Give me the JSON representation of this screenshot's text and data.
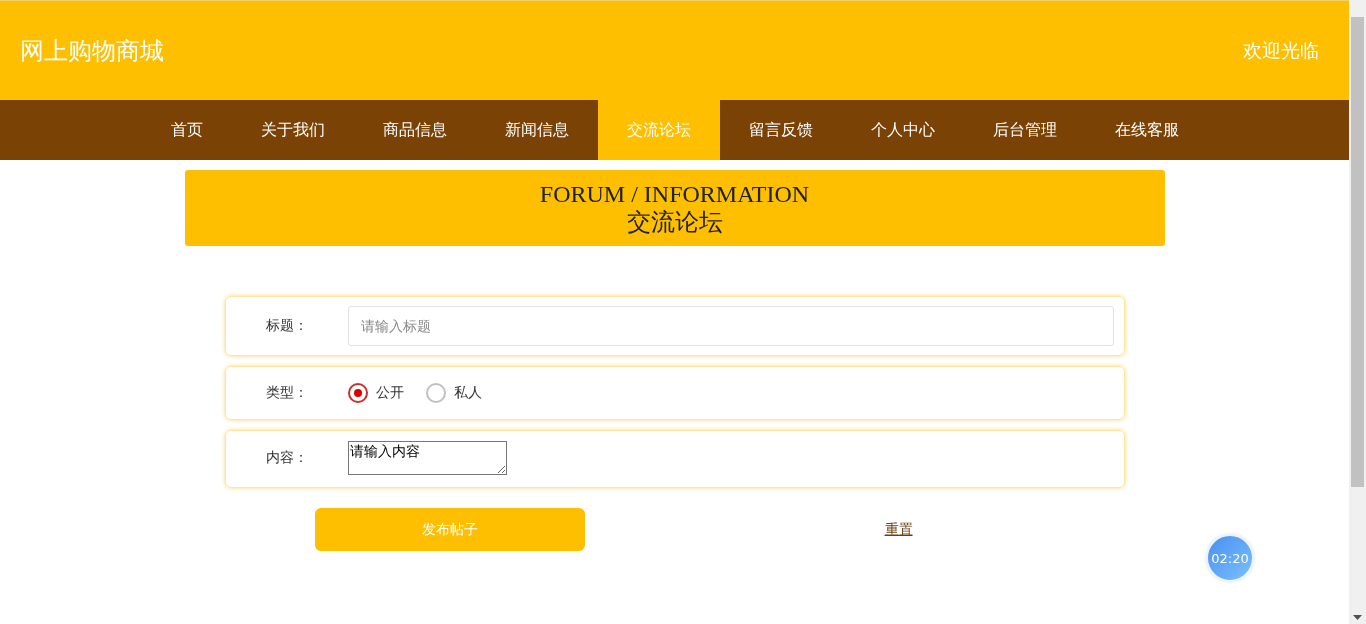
{
  "header": {
    "title": "网上购物商城",
    "welcome": "欢迎光临"
  },
  "nav": [
    {
      "label": "首页",
      "selected": false
    },
    {
      "label": "关于我们",
      "selected": false
    },
    {
      "label": "商品信息",
      "selected": false
    },
    {
      "label": "新闻信息",
      "selected": false
    },
    {
      "label": "交流论坛",
      "selected": true
    },
    {
      "label": "留言反馈",
      "selected": false
    },
    {
      "label": "个人中心",
      "selected": false
    },
    {
      "label": "后台管理",
      "selected": false
    },
    {
      "label": "在线客服",
      "selected": false
    }
  ],
  "banner": {
    "title_en": "FORUM / INFORMATION",
    "title": "交流论坛"
  },
  "form": {
    "fields": [
      {
        "kind": "text",
        "label": "标题：",
        "placeholder": "请输入标题"
      },
      {
        "kind": "radio",
        "label": "类型：",
        "options": [
          {
            "label": "公开",
            "selected": true
          },
          {
            "label": "私人",
            "selected": false
          }
        ]
      },
      {
        "kind": "textarea",
        "label": "内容：",
        "value": "请输入内容"
      }
    ],
    "submit": "发布帖子",
    "reset": "重置"
  },
  "timer": "02:20"
}
